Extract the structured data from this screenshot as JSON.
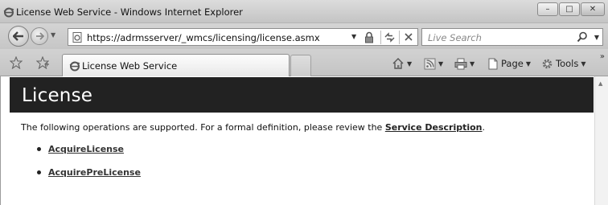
{
  "window": {
    "title": "License Web Service - Windows Internet Explorer",
    "minimize_glyph": "–",
    "maximize_glyph": "□",
    "close_glyph": "✕"
  },
  "address_bar": {
    "url": "https://adrmsserver/_wmcs/licensing/license.asmx"
  },
  "search": {
    "placeholder": "Live Search"
  },
  "tab": {
    "title": "License Web Service"
  },
  "commands": {
    "page_label": "Page",
    "tools_label": "Tools"
  },
  "page": {
    "heading": "License",
    "intro_text": "The following operations are supported. For a formal definition, please review the ",
    "service_description_link": "Service Description",
    "intro_end": ".",
    "operations": [
      {
        "label": "AcquireLicense"
      },
      {
        "label": "AcquirePreLicense"
      }
    ]
  },
  "colors": {
    "banner": "#222222",
    "chrome": "#c8c8c8"
  },
  "icons": {
    "browser": "ie-icon",
    "back": "back-arrow-icon",
    "forward": "forward-arrow-icon",
    "lock": "lock-icon",
    "refresh": "refresh-icon",
    "stop": "stop-icon",
    "search": "search-icon",
    "favorites": "favorites-star-icon",
    "add_favorites": "add-favorites-icon",
    "home": "home-icon",
    "feeds": "feeds-icon",
    "print": "print-icon",
    "page": "page-icon",
    "tools": "gear-icon"
  }
}
